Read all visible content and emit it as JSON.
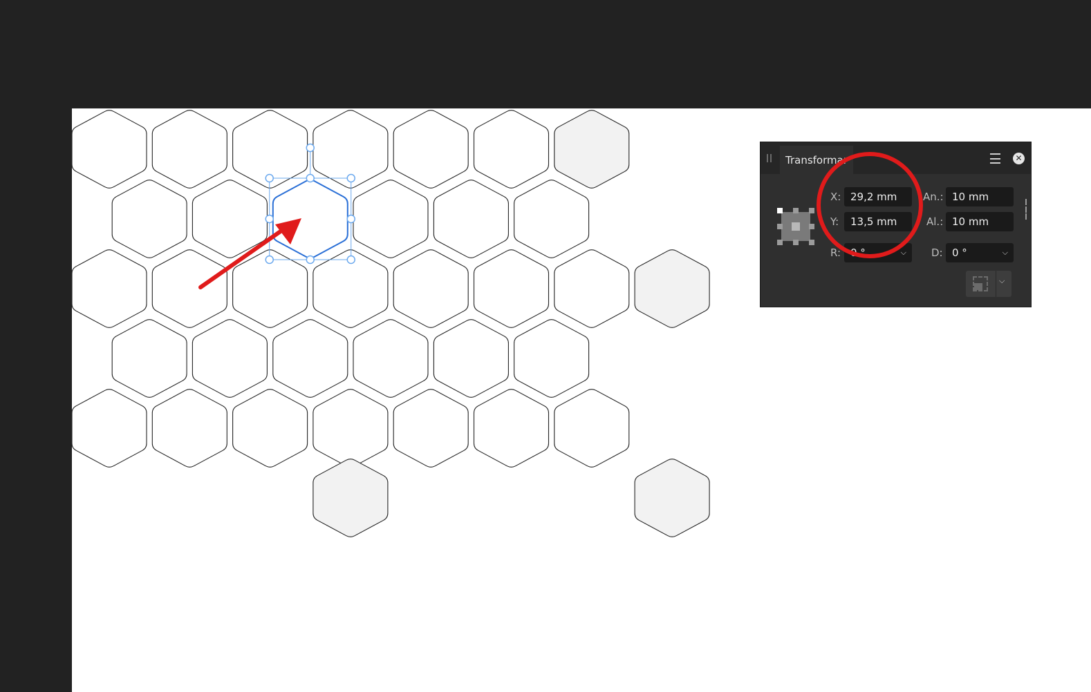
{
  "canvas": {
    "hex_rows": [
      {
        "offset": 0,
        "count": 7,
        "filled": [
          6
        ]
      },
      {
        "offset": 1,
        "count": 6,
        "filled": []
      },
      {
        "offset": 0,
        "count": 8,
        "filled": [
          7
        ]
      },
      {
        "offset": 1,
        "count": 6,
        "filled": []
      },
      {
        "offset": 0,
        "count": 7,
        "filled": []
      }
    ],
    "extra_hexes": [
      {
        "row": 5,
        "col": 3,
        "filled": true
      },
      {
        "row": 5,
        "col": 7,
        "filled": true
      }
    ],
    "selected_hex": {
      "row": 1,
      "col": 2
    },
    "colors": {
      "hex_stroke": "#222222",
      "hex_fill_shaded": "#f2f2f2",
      "selection": "#2a6fd6",
      "selection_handles": "#6aa8ee",
      "annotation": "#e01b1b"
    }
  },
  "transform_panel": {
    "title": "Transformar",
    "menu_icon": "hamburger-menu-icon",
    "close_icon": "close-circle-icon",
    "x_label": "X:",
    "x_value": "29,2 mm",
    "y_label": "Y:",
    "y_value": "13,5 mm",
    "w_label": "An.:",
    "w_value": "10 mm",
    "h_label": "Al.:",
    "h_value": "10 mm",
    "r_label": "R:",
    "r_value": "0 °",
    "d_label": "D:",
    "d_value": "0 °"
  }
}
